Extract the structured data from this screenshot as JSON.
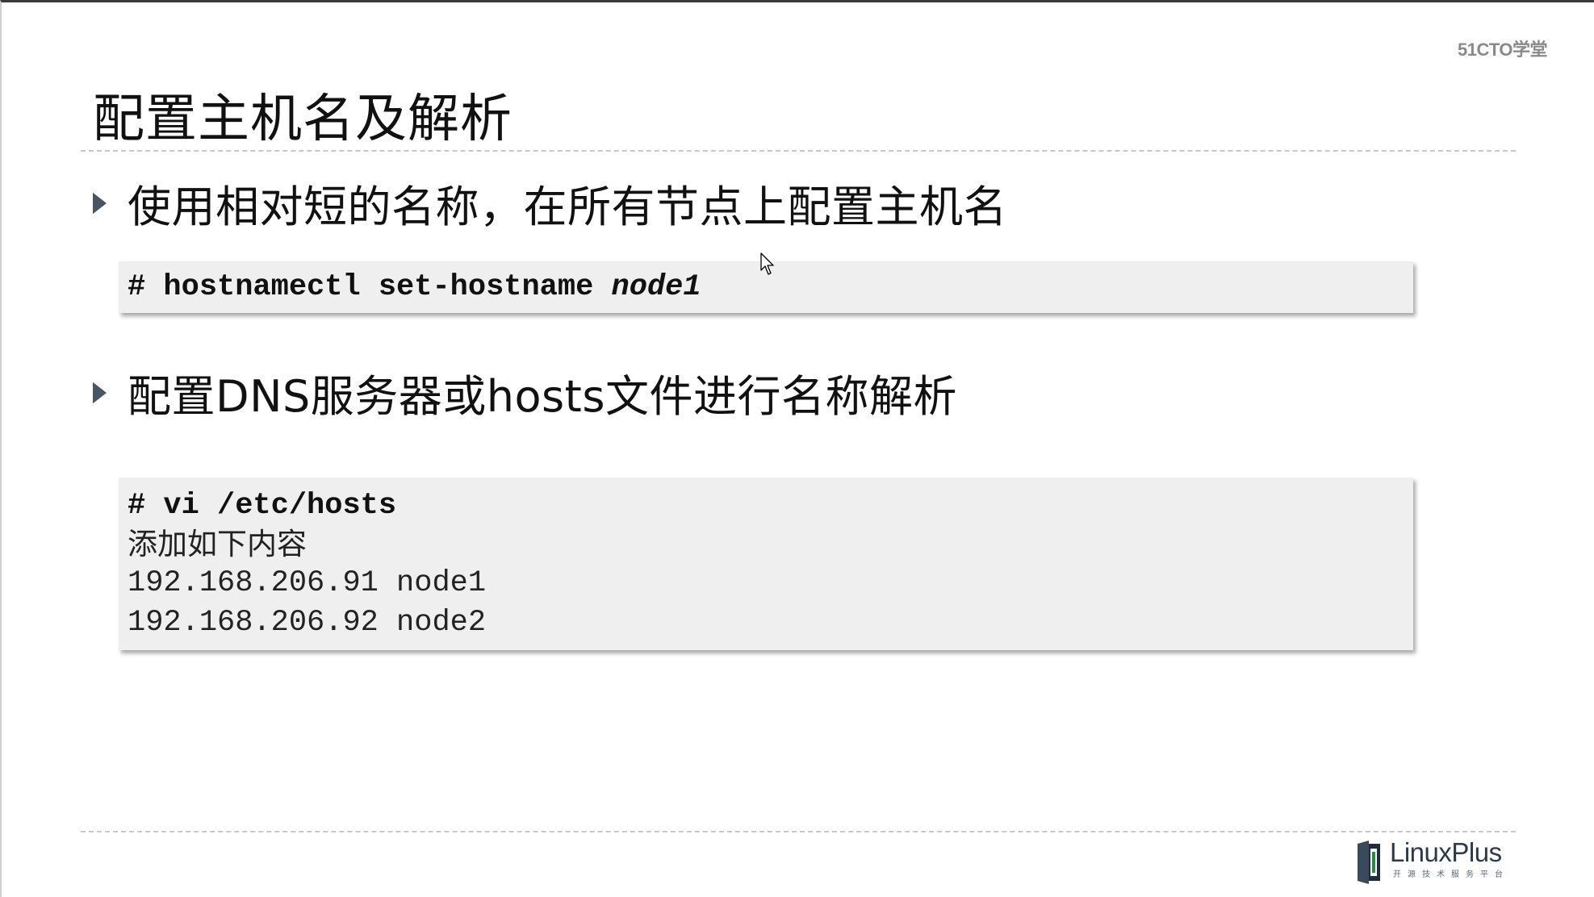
{
  "brand": "51CTO学堂",
  "title": "配置主机名及解析",
  "bullets": [
    {
      "text": "使用相对短的名称，在所有节点上配置主机名"
    },
    {
      "text": "配置DNS服务器或hosts文件进行名称解析"
    }
  ],
  "code1": {
    "command": "# hostnamectl set-hostname ",
    "argument": "node1"
  },
  "code2": {
    "command": "# vi /etc/hosts",
    "lines": [
      "添加如下内容",
      "192.168.206.91 node1",
      "192.168.206.92 node2"
    ]
  },
  "footer_logo": {
    "name": "LinuxPlus",
    "tagline": "开源技术服务平台"
  },
  "colors": {
    "code_background": "#efefef",
    "bullet_arrow": "#4a5563",
    "brand_gray": "#8a8a8a"
  },
  "icons": {
    "bullet": "triangle-right-icon",
    "cursor": "mouse-pointer-icon",
    "logo": "linuxplus-logo-icon"
  }
}
